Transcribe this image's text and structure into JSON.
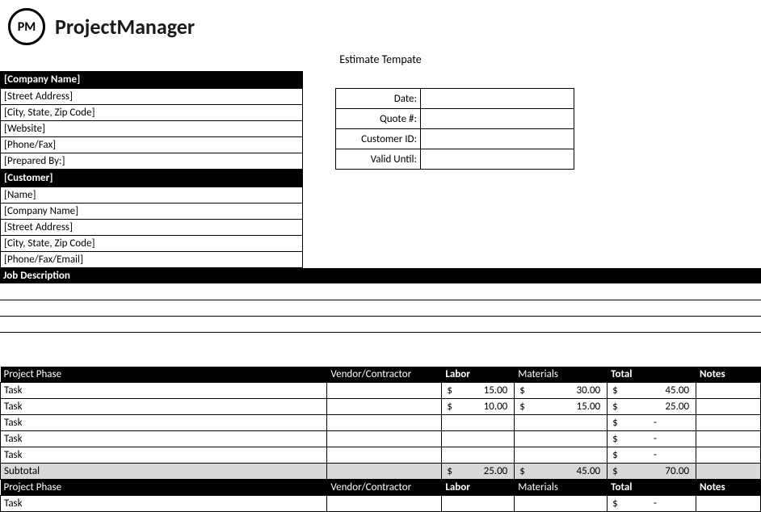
{
  "logo": {
    "badge": "PM",
    "brand": "ProjectManager"
  },
  "title": "Estimate Tempate",
  "company": {
    "header": "[Company Name]",
    "fields": [
      "[Street Address]",
      "[City, State, Zip Code]",
      "[Website]",
      "[Phone/Fax]",
      "[Prepared By:]"
    ]
  },
  "meta": {
    "labels": [
      "Date:",
      "Quote #:",
      "Customer ID:",
      "Valid Until:"
    ],
    "values": [
      "",
      "",
      "",
      ""
    ]
  },
  "customer": {
    "header": "[Customer]",
    "fields": [
      "[Name]",
      "[Company Name]",
      "[Street Address]",
      "[City, State, Zip Code]",
      "[Phone/Fax/Email]"
    ]
  },
  "job_description": {
    "header": "Job Description",
    "rows": [
      "",
      "",
      ""
    ]
  },
  "phase_headers": {
    "phase": "Project Phase",
    "vendor": "Vendor/Contractor",
    "labor": "Labor",
    "materials": "Materials",
    "total": "Total",
    "notes": "Notes"
  },
  "phase1": {
    "tasks": [
      {
        "name": "Task",
        "vendor": "",
        "labor": "15.00",
        "materials": "30.00",
        "total": "45.00",
        "notes": ""
      },
      {
        "name": "Task",
        "vendor": "",
        "labor": "10.00",
        "materials": "15.00",
        "total": "25.00",
        "notes": ""
      },
      {
        "name": "Task",
        "vendor": "",
        "labor": "",
        "materials": "",
        "total": "-",
        "notes": ""
      },
      {
        "name": "Task",
        "vendor": "",
        "labor": "",
        "materials": "",
        "total": "-",
        "notes": ""
      },
      {
        "name": "Task",
        "vendor": "",
        "labor": "",
        "materials": "",
        "total": "-",
        "notes": ""
      }
    ],
    "subtotal": {
      "label": "Subtotal",
      "labor": "25.00",
      "materials": "45.00",
      "total": "70.00"
    }
  },
  "phase2": {
    "tasks": [
      {
        "name": "Task",
        "vendor": "",
        "labor": "",
        "materials": "",
        "total": "-",
        "notes": ""
      }
    ]
  },
  "currency": "$"
}
